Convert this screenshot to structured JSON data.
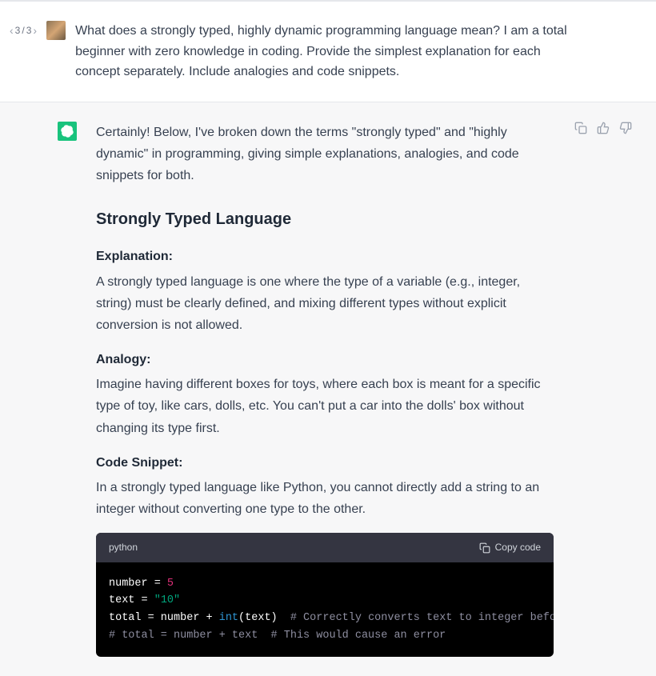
{
  "nav": {
    "current": "3",
    "total": "3"
  },
  "user": {
    "message": "What does a strongly typed, highly dynamic programming language mean? I am a total beginner with zero knowledge in coding. Provide the simplest explanation for each concept separately. Include analogies and code snippets."
  },
  "assistant": {
    "intro": "Certainly! Below, I've broken down the terms \"strongly typed\" and \"highly dynamic\" in programming, giving simple explanations, analogies, and code snippets for both.",
    "heading": "Strongly Typed Language",
    "explanation_label": "Explanation:",
    "explanation_text": "A strongly typed language is one where the type of a variable (e.g., integer, string) must be clearly defined, and mixing different types without explicit conversion is not allowed.",
    "analogy_label": "Analogy:",
    "analogy_text": "Imagine having different boxes for toys, where each box is meant for a specific type of toy, like cars, dolls, etc. You can't put a car into the dolls' box without changing its type first.",
    "snippet_label": "Code Snippet:",
    "snippet_text": "In a strongly typed language like Python, you cannot directly add a string to an integer without converting one type to the other.",
    "code": {
      "lang": "python",
      "copy_label": "Copy code",
      "line1_a": "number = ",
      "line1_num": "5",
      "line2_a": "text = ",
      "line2_str": "\"10\"",
      "line3_a": "total = number + ",
      "line3_builtin": "int",
      "line3_b": "(text)  ",
      "line3_comment": "# Correctly converts text to integer before addi",
      "line4_comment": "# total = number + text  # This would cause an error"
    }
  }
}
